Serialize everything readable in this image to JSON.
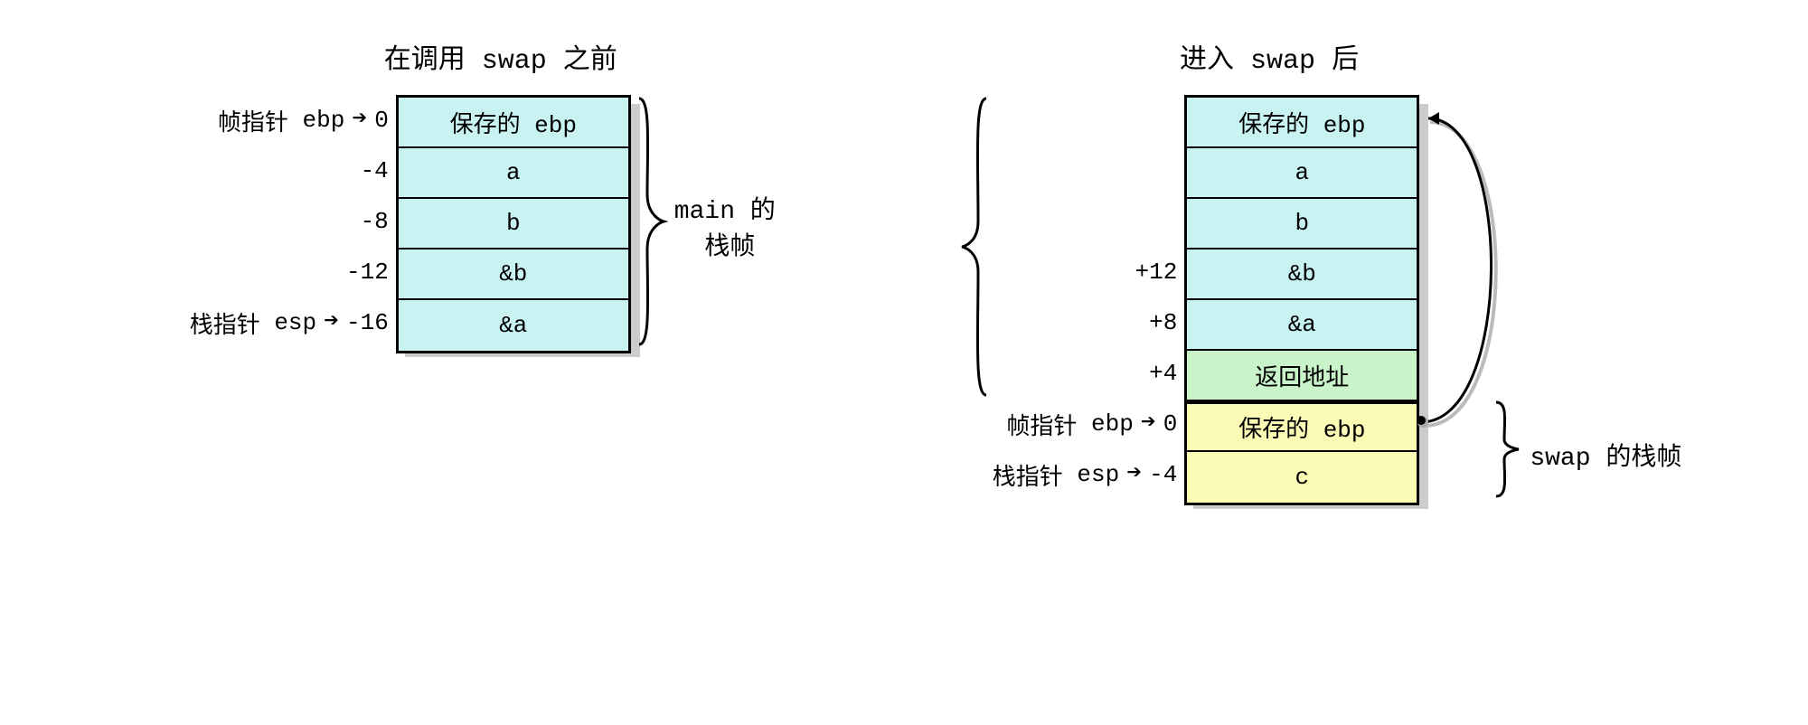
{
  "left": {
    "title_prefix": "在调用",
    "title_code": "swap",
    "title_suffix": "之前",
    "pointers": {
      "ebp_label": "帧指针",
      "ebp_code": "ebp",
      "esp_label": "栈指针",
      "esp_code": "esp"
    },
    "rows": [
      {
        "offset": "0",
        "content": "保存的 ebp"
      },
      {
        "offset": "-4",
        "content": "a"
      },
      {
        "offset": "-8",
        "content": "b"
      },
      {
        "offset": "-12",
        "content": "&b"
      },
      {
        "offset": "-16",
        "content": "&a"
      }
    ],
    "brace_label_line1": "main 的",
    "brace_label_line2": "栈帧"
  },
  "right": {
    "title_prefix": "进入",
    "title_code": "swap",
    "title_suffix": "后",
    "pointers": {
      "ebp_label": "帧指针",
      "ebp_code": "ebp",
      "esp_label": "栈指针",
      "esp_code": "esp"
    },
    "rows": [
      {
        "offset": "",
        "content": "保存的 ebp",
        "color": "cyan"
      },
      {
        "offset": "",
        "content": "a",
        "color": "cyan"
      },
      {
        "offset": "",
        "content": "b",
        "color": "cyan"
      },
      {
        "offset": "+12",
        "content": "&b",
        "color": "cyan"
      },
      {
        "offset": "+8",
        "content": "&a",
        "color": "cyan"
      },
      {
        "offset": "+4",
        "content": "返回地址",
        "color": "green"
      },
      {
        "offset": "0",
        "content": "保存的 ebp",
        "color": "yellow"
      },
      {
        "offset": "-4",
        "content": "c",
        "color": "yellow"
      }
    ],
    "swap_brace_label": "swap 的栈帧"
  }
}
